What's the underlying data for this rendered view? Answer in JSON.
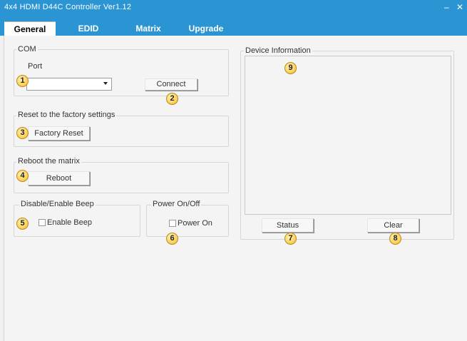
{
  "window": {
    "title": "4x4 HDMI D44C Controller Ver1.12",
    "minimize": "–",
    "close": "✕",
    "colors": {
      "titlebar": "#2b94d3",
      "background": "#f4f4f4"
    }
  },
  "tabs": [
    {
      "label": "General",
      "active": true
    },
    {
      "label": "EDID",
      "active": false
    },
    {
      "label": "Matrix",
      "active": false
    },
    {
      "label": "Upgrade",
      "active": false
    }
  ],
  "com": {
    "group_label": "COM",
    "port_label": "Port",
    "port_value": "",
    "connect_label": "Connect"
  },
  "factory": {
    "group_label": "Reset to the factory settings",
    "button_label": "Factory Reset"
  },
  "reboot": {
    "group_label": "Reboot the matrix",
    "button_label": "Reboot"
  },
  "beep": {
    "group_label": "Disable/Enable Beep",
    "checkbox_label": "Enable Beep",
    "checked": false
  },
  "power": {
    "group_label": "Power On/Off",
    "checkbox_label": "Power On",
    "checked": false
  },
  "device": {
    "group_label": "Device Information",
    "content": "",
    "status_label": "Status",
    "clear_label": "Clear"
  },
  "badges": [
    "1",
    "2",
    "3",
    "4",
    "5",
    "6",
    "7",
    "8",
    "9"
  ]
}
